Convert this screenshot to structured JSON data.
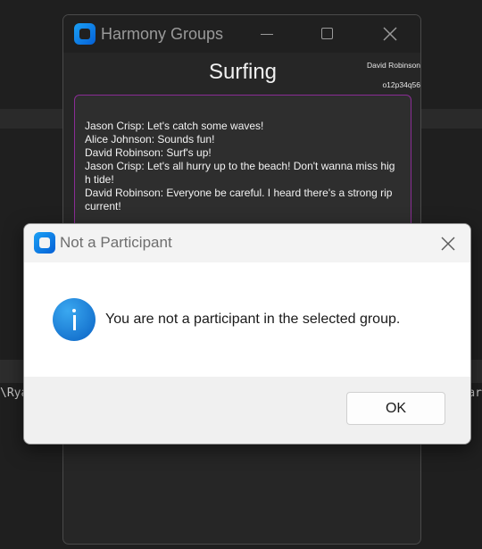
{
  "background": {
    "left_path_text": "\\Rya",
    "right_path_text": "ar"
  },
  "main_window": {
    "title": "Harmony Groups",
    "group_title": "Surfing",
    "user": {
      "name": "David Robinson",
      "id": "o12p34q56"
    },
    "messages": [
      "Jason Crisp: Let's catch some waves!",
      "Alice Johnson: Sounds fun!",
      "David Robinson: Surf's up!",
      "Jason Crisp: Let's all hurry up to the beach! Don't wanna miss high tide!",
      "David Robinson: Everyone be careful. I heard there's a strong rip current!"
    ],
    "accent_color": "#8a2c95"
  },
  "dialog": {
    "title": "Not a Participant",
    "message": "You are not a participant in the selected group.",
    "icon": "info-icon",
    "ok_label": "OK"
  }
}
